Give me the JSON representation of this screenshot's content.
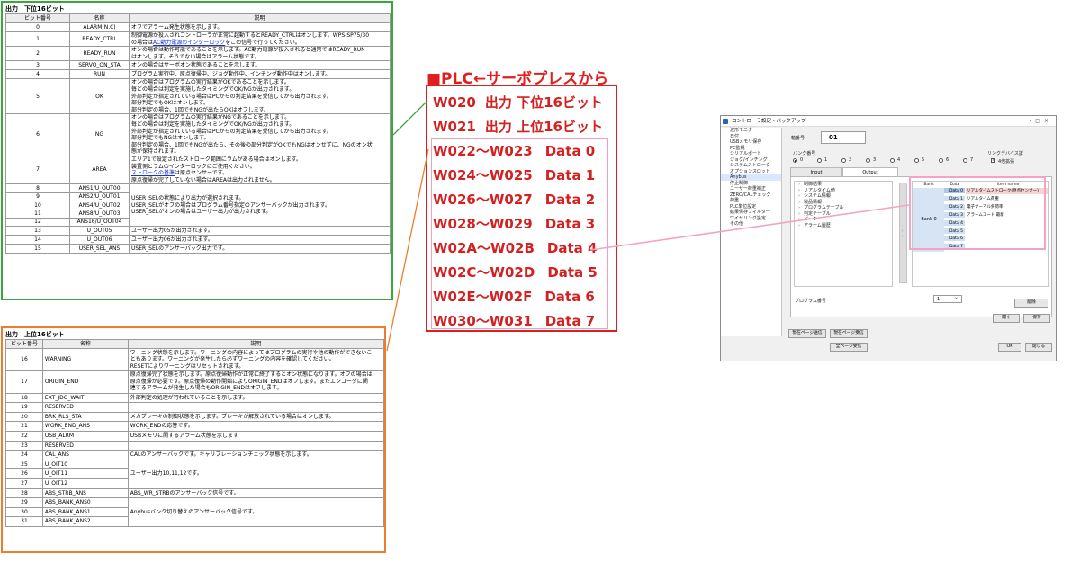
{
  "lower": {
    "title": "出力　下位16ビット",
    "headers": [
      "ビット番号",
      "名称",
      "説明"
    ],
    "rows": [
      {
        "bit": "0",
        "name": "ALARM(N.C)",
        "desc": [
          "オフでアラーム発生状態を示します。"
        ]
      },
      {
        "bit": "1",
        "name": "READY_CTRL",
        "desc": [
          "制御電源が投入されコントローラが正常に起動するとREADY_CTRLはオンします。WPS-SP75/30",
          "の場合はAC動力電源のインターロックをこの信号で行ってください。"
        ]
      },
      {
        "bit": "2",
        "name": "READY_RUN",
        "desc": [
          "オンの場合は動作可能であることを示します。AC動力電源が投入されると通常ではREADY_RUN",
          "はオンします。そうでない場合はアラーム状態です。"
        ]
      },
      {
        "bit": "3",
        "name": "SERVO_ON_STA",
        "desc": [
          "オンの場合はサーボオン状態であることを示します。"
        ]
      },
      {
        "bit": "4",
        "name": "RUN",
        "desc": [
          "プログラム実行中、原点復帰中、ジョグ動作中、インチング動作中はオンします。"
        ]
      },
      {
        "bit": "5",
        "name": "OK",
        "desc": [
          "オンの場合はプログラムの実行結果がOKであることを示します。",
          "毎どの場合は判定を実施したタイミングでOK/NGが出力されます。",
          "外部判定が指定されている場合はPCからの判定結果を受信してから出力されます。",
          "部分判定でもOKはオンします。",
          "部分判定の場合、1回でもNGが出たらOKはオフします。"
        ]
      },
      {
        "bit": "6",
        "name": "NG",
        "desc": [
          "オンの場合はプログラムの実行結果がNGであることを示します。",
          "毎どの場合は判定を実施したタイミングでOK/NGが出力されます。",
          "外部判定が指定されている場合はPCからの判定結果を受信してから出力されます。",
          "部分判定でもNGはオンします。",
          "部分判定の場合、1回でもNGが出たら、その後の部分判定がOKでもNGはオンせずに、NGのオン状",
          "態が保持されます。"
        ]
      },
      {
        "bit": "7",
        "name": "AREA",
        "desc": [
          "エリア1で設定されたストローク範囲にラムがある場合はオンします。",
          "装置側とラムのインターロックにご使用ください。",
          "ストロークの基準は原点センサーです。",
          "原点復帰が完了していない場合はAREAは出力されません。"
        ]
      },
      {
        "bit": "8",
        "name": "ANS1/U_OUT00"
      },
      {
        "bit": "9",
        "name": "ANS2/U_OUT01"
      },
      {
        "bit": "10",
        "name": "ANS4/U_OUT02"
      },
      {
        "bit": "11",
        "name": "ANS8/U_OUT03"
      },
      {
        "bit": "12",
        "name": "ANS16/U_OUT04"
      },
      {
        "bit": "13",
        "name": "U_OUT05",
        "desc": [
          "ユーザー出力05が出力されます。"
        ]
      },
      {
        "bit": "14",
        "name": "U_OUT06",
        "desc": [
          "ユーザー出力06が出力されます。"
        ]
      },
      {
        "bit": "15",
        "name": "USER_SEL_ANS",
        "desc": [
          "USER_SELのアンサーバック出力です。"
        ]
      }
    ],
    "group_desc": [
      "USER_SELの状態により出力が選択されます。",
      "USER_SELがオフの場合はプログラム番号指定のアンサーバックが出力されます。",
      "USER_SELがオンの場合はユーザー出力が出力されます。"
    ],
    "link1": "AC動力電源のインターロック",
    "link7": "ストロークの基準"
  },
  "upper": {
    "title": "出力　上位16ビット",
    "headers": [
      "ビット番号",
      "名称",
      "説明"
    ],
    "rows": [
      {
        "bit": "16",
        "name": "WARNING",
        "desc": [
          "ワーニング状態を示します。ワーニングの内容によってはプログラムの実行や他の動作ができないこ",
          "ともあります。ワーニングが発生したら必ずワーニングの内容を確認してください。",
          "RESETによりワーニングはリセットされます。"
        ]
      },
      {
        "bit": "17",
        "name": "ORIGIN_END",
        "desc": [
          "原点復帰完了状態を示します。原点復帰動作が正常に終了するとオン状態になります。オフの場合は",
          "原点復帰が必要です。原点復帰の動作開始によりORIGIN_ENDはオフします。またエンコーダに関",
          "連するアラームが発生した場合もORIGIN_ENDはオフします。"
        ]
      },
      {
        "bit": "18",
        "name": "EXT_JDG_WAIT",
        "desc": [
          "外部判定の処理が行われていることを示します。"
        ]
      },
      {
        "bit": "19",
        "name": "RESERVED",
        "desc": []
      },
      {
        "bit": "20",
        "name": "BRK_RLS_STA",
        "desc": [
          "メカブレーキの制御状態を示します。ブレーキが解放されている場合はオンします。"
        ]
      },
      {
        "bit": "21",
        "name": "WORK_END_ANS",
        "desc": [
          "WORK_ENDの応答です。"
        ]
      },
      {
        "bit": "22",
        "name": "USB_ALRM",
        "desc": [
          "USBメモリに関するアラーム状態を示します"
        ]
      },
      {
        "bit": "23",
        "name": "RESERVED",
        "desc": []
      },
      {
        "bit": "24",
        "name": "CAL_ANS",
        "desc": [
          "CALのアンサーバックです。キャリブレーションチェック状態を示します。"
        ]
      },
      {
        "bit": "25",
        "name": "U_OIT10"
      },
      {
        "bit": "26",
        "name": "U_OIT11"
      },
      {
        "bit": "27",
        "name": "U_OIT12"
      },
      {
        "bit": "28",
        "name": "ABS_STRB_ANS",
        "desc": [
          "ABS_WR_STRBのアンサーバック信号です。"
        ]
      },
      {
        "bit": "29",
        "name": "ABS_BANK_ANS0"
      },
      {
        "bit": "30",
        "name": "ABS_BANK_ANS1"
      },
      {
        "bit": "31",
        "name": "ABS_BANK_ANS2"
      }
    ],
    "group_uout_desc": "ユーザー出力10,11,12です。",
    "group_bank_desc": "Anybusバンク切り替えのアンサーバック信号です。"
  },
  "plc": {
    "title": "■PLC←サーボプレスから",
    "rows": [
      {
        "addr": "W020",
        "text": "出力 下位16ビット"
      },
      {
        "addr": "W021",
        "text": "出力 上位16ビット"
      },
      {
        "addr": "W022～W023",
        "text": "Data 0"
      },
      {
        "addr": "W024～W025",
        "text": "Data 1"
      },
      {
        "addr": "W026～W027",
        "text": "Data 2"
      },
      {
        "addr": "W028～W029",
        "text": "Data 3"
      },
      {
        "addr": "W02A～W02B",
        "text": "Data 4"
      },
      {
        "addr": "W02C～W02D",
        "text": "Data 5"
      },
      {
        "addr": "W02E～W02F",
        "text": "Data 6"
      },
      {
        "addr": "W030～W031",
        "text": "Data 7"
      }
    ]
  },
  "window": {
    "title": "コントローラ設定 - バックアップ",
    "titlebar_buttons": "-□×",
    "nav": [
      "波形モニター",
      "日付",
      "USBメモリ保存",
      "PC監視",
      "シリアルポート",
      "ジョグ/インチング",
      "システムストローク",
      "オプションスロット",
      "Anybus",
      "停止制御",
      "ユーザー荷重補正",
      "ZERO/CALチェック",
      "荷重",
      "PLC単位設定",
      "結果保存フィルター",
      "ワイヤリング設定",
      "その他"
    ],
    "nav_selected": 8,
    "axis_label": "軸番号",
    "axis_value": "01",
    "bank_label": "バンク番号",
    "bank_options": [
      "0",
      "1",
      "2",
      "3",
      "4",
      "5",
      "6",
      "7"
    ],
    "swap_label": "リンクデバイス詳",
    "swap_option": "4倍拡張",
    "tabs": [
      "Input",
      "Output"
    ],
    "tree": [
      "制御結果",
      "リアルタイム値",
      "システム情報",
      "製品情報",
      "プログラムテーブル",
      "判定テーブル",
      "ピーク",
      "アラーム履歴"
    ],
    "grid_headers": [
      "Bank",
      "Data",
      "Item name"
    ],
    "bank_label_cell": "Bank 0",
    "data_rows": [
      {
        "data": "Data 0",
        "item": "リアルタイムストローク(原点センサー)"
      },
      {
        "data": "Data 1",
        "item": "リアルタイム荷重"
      },
      {
        "data": "Data 2",
        "item": "電子サーマル負荷率"
      },
      {
        "data": "Data 3",
        "item": "アラームコード 最新"
      },
      {
        "data": "Data 4",
        "item": ""
      },
      {
        "data": "Data 5",
        "item": ""
      },
      {
        "data": "Data 6",
        "item": ""
      },
      {
        "data": "Data 7",
        "item": ""
      }
    ],
    "program_label": "プログラム番号",
    "program_value": "1",
    "delete_btn": "削除",
    "open_btn": "開く",
    "save_btn": "保存",
    "send_page_btn": "現在ページ送信",
    "recv_page_btn": "現在ページ受信",
    "recv_all_btn": "全ページ受信",
    "ok_btn": "OK",
    "close_btn": "閉じる"
  },
  "colors": {
    "lower_frame": "#3aa640",
    "upper_frame": "#ee7d2b",
    "plc_red": "#e01e1e",
    "pink": "#f4a2c6"
  }
}
